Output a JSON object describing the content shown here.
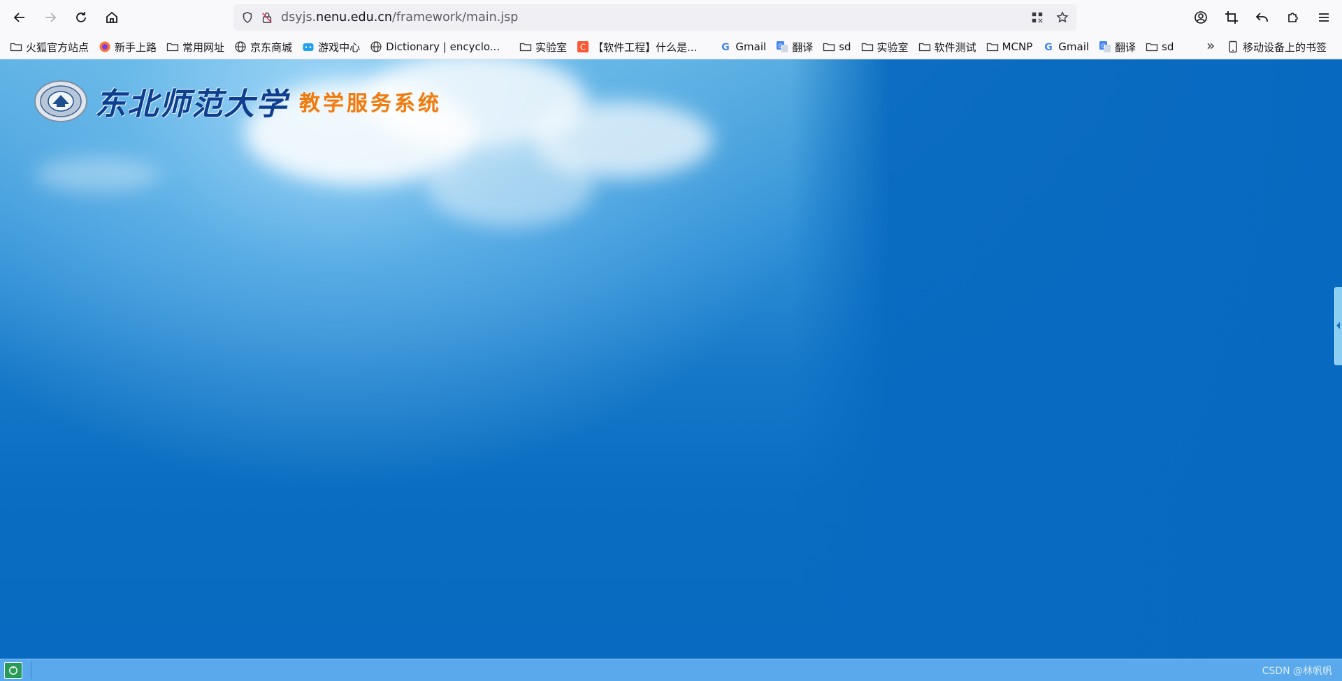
{
  "browser": {
    "url_prefix": "dsyjs.",
    "url_host": "nenu.edu.cn",
    "url_path": "/framework/main.jsp"
  },
  "bookmarks": [
    {
      "label": "火狐官方站点",
      "icon": "folder-icon"
    },
    {
      "label": "新手上路",
      "icon": "firefox-icon"
    },
    {
      "label": "常用网址",
      "icon": "folder-icon"
    },
    {
      "label": "京东商城",
      "icon": "globe-icon"
    },
    {
      "label": "游戏中心",
      "icon": "game-icon"
    },
    {
      "label": "Dictionary | encyclo...",
      "icon": "globe-icon"
    },
    {
      "label": "实验室",
      "icon": "folder-icon"
    },
    {
      "label": "【软件工程】什么是...",
      "icon": "csdn-icon"
    },
    {
      "label": "Gmail",
      "icon": "google-icon"
    },
    {
      "label": "翻译",
      "icon": "translate-icon"
    },
    {
      "label": "sd",
      "icon": "folder-icon"
    },
    {
      "label": "实验室",
      "icon": "folder-icon"
    },
    {
      "label": "软件测试",
      "icon": "folder-icon"
    },
    {
      "label": "MCNP",
      "icon": "folder-icon"
    },
    {
      "label": "Gmail",
      "icon": "google-icon"
    },
    {
      "label": "翻译",
      "icon": "translate-icon"
    },
    {
      "label": "sd",
      "icon": "folder-icon"
    }
  ],
  "bookmarks_mobile_label": "移动设备上的书签",
  "page": {
    "university_name": "东北师范大学",
    "system_name": "教学服务系统"
  },
  "statusbar": {
    "watermark": "CSDN @林帆帆"
  },
  "colors": {
    "page_blue": "#0a6dc1",
    "system_title_orange": "#f07a12",
    "statusbar_blue": "#59a9ec"
  }
}
